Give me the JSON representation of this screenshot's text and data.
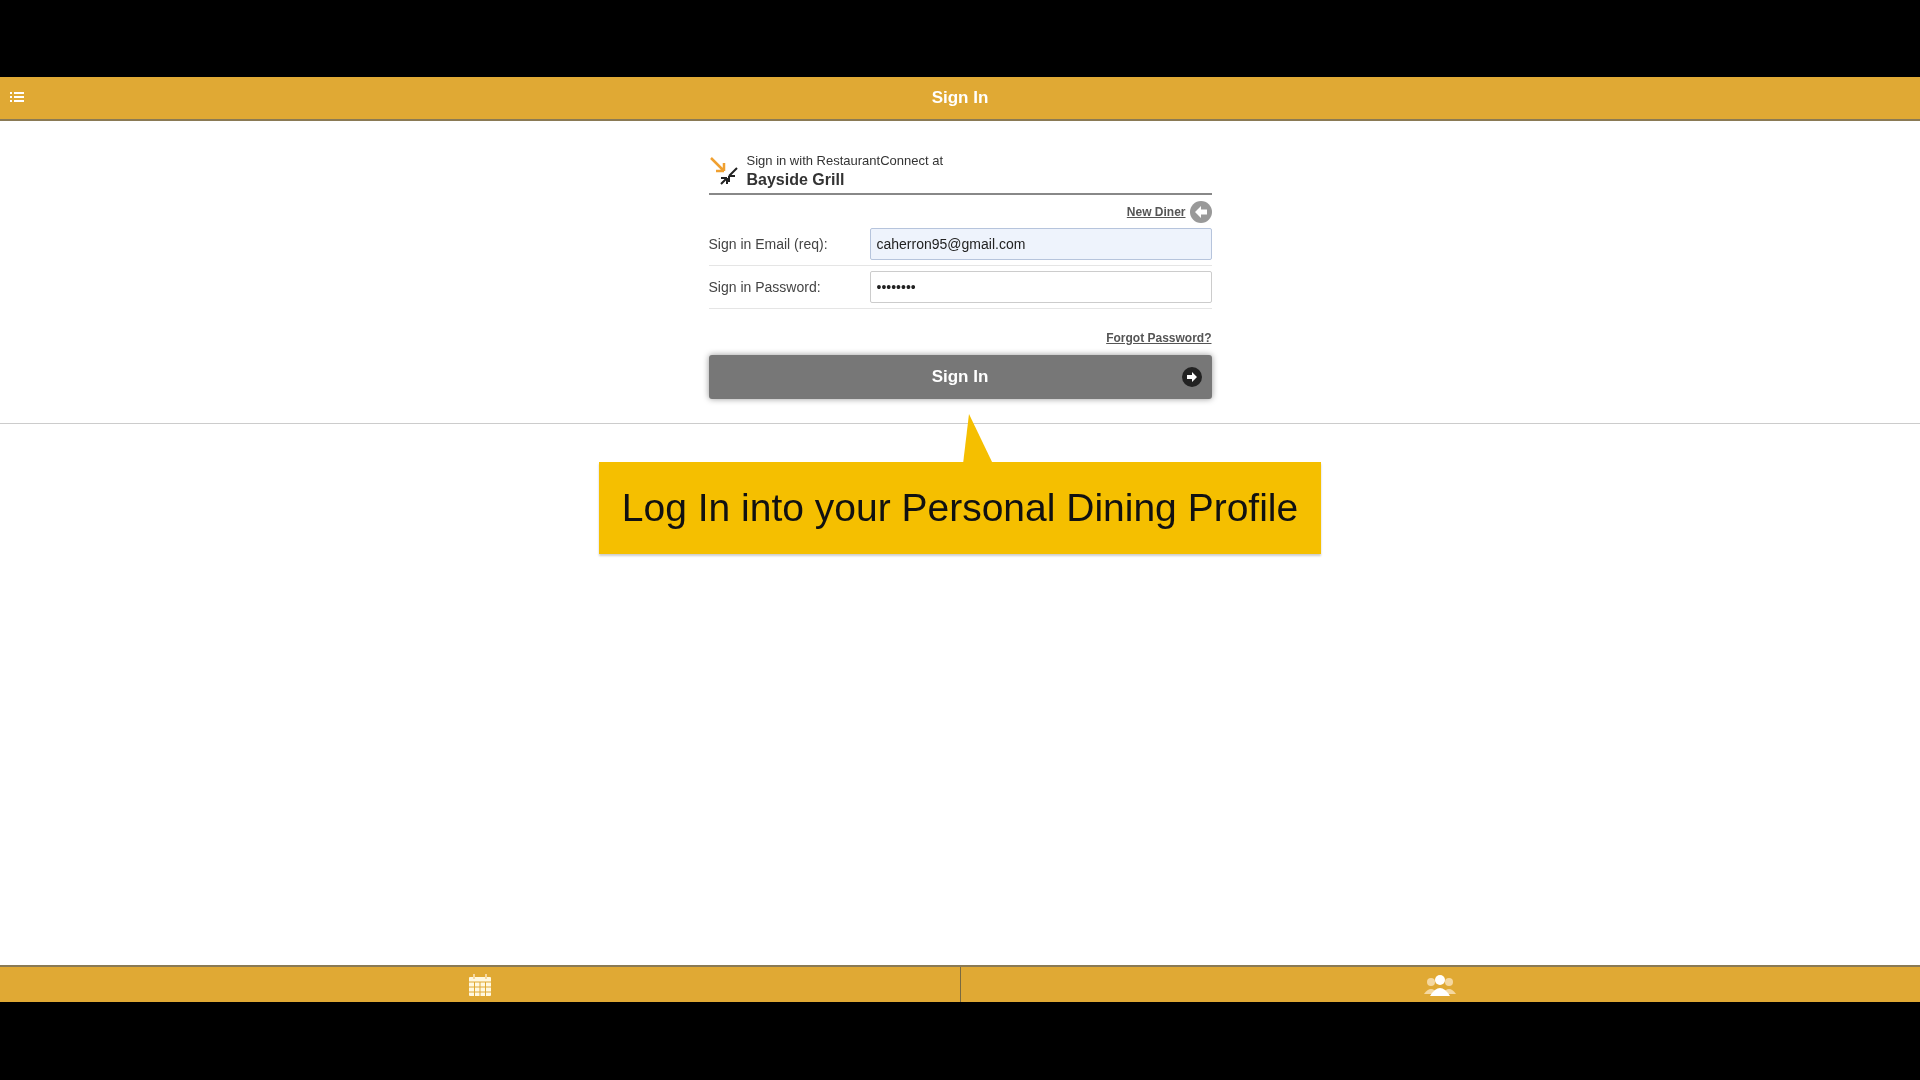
{
  "header": {
    "title": "Sign In"
  },
  "brand": {
    "tagline": "Sign in with RestaurantConnect at",
    "restaurant": "Bayside Grill"
  },
  "new_diner_link": "New Diner",
  "fields": [
    {
      "label": "Sign in Email (req):",
      "value": "caherron95@gmail.com",
      "focused": true
    },
    {
      "label": "Sign in Password:",
      "value": "••••••••",
      "focused": false
    }
  ],
  "forgot_link": "Forgot Password?",
  "sign_in_button": "Sign In",
  "callout": "Log In into your Personal Dining Profile",
  "footer_tabs": [
    {
      "kind": "calendar"
    },
    {
      "kind": "people"
    }
  ]
}
